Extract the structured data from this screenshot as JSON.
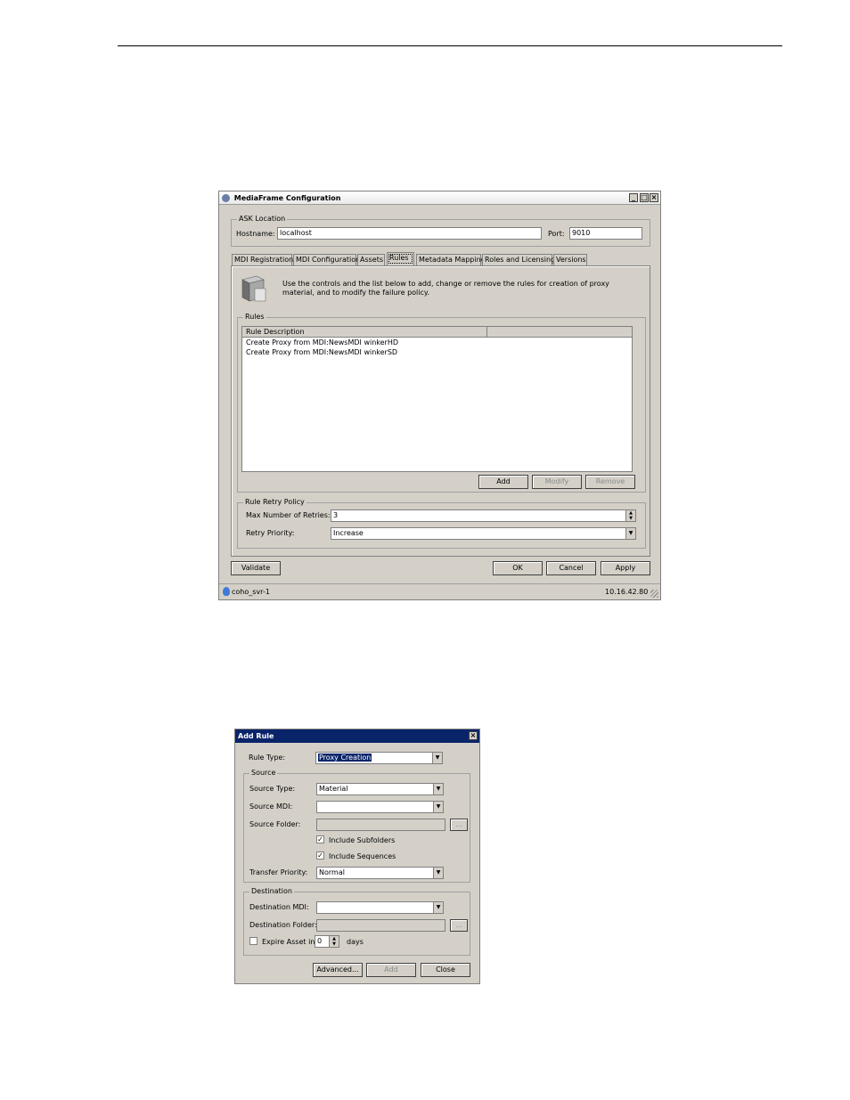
{
  "config_window": {
    "title": "MediaFrame Configuration",
    "ask_location": {
      "group_label": "ASK Location",
      "hostname_label": "Hostname:",
      "hostname_value": "localhost",
      "port_label": "Port:",
      "port_value": "9010"
    },
    "tabs": [
      {
        "label": "MDI Registration"
      },
      {
        "label": "MDI Configuration"
      },
      {
        "label": "Assets"
      },
      {
        "label": "Rules",
        "active": true
      },
      {
        "label": "Metadata Mapping"
      },
      {
        "label": "Roles and Licensing"
      },
      {
        "label": "Versions"
      }
    ],
    "description": "Use the controls and the list below to add, change or remove the rules for creation of proxy material, and to modify the failure policy.",
    "rules": {
      "group_label": "Rules",
      "column_header": "Rule Description",
      "rows": [
        "Create Proxy from MDI:NewsMDI winkerHD",
        "Create Proxy from MDI:NewsMDI winkerSD"
      ],
      "add_label": "Add",
      "modify_label": "Modify",
      "remove_label": "Remove"
    },
    "retry_policy": {
      "group_label": "Rule Retry Policy",
      "max_retries_label": "Max Number of Retries:",
      "max_retries_value": "3",
      "retry_priority_label": "Retry Priority:",
      "retry_priority_value": "Increase"
    },
    "validate_label": "Validate",
    "ok_label": "OK",
    "cancel_label": "Cancel",
    "apply_label": "Apply",
    "status": {
      "left": "coho_svr-1",
      "right": "10.16.42.80"
    }
  },
  "add_rule": {
    "title": "Add Rule",
    "rule_type_label": "Rule Type:",
    "rule_type_value": "Proxy Creation",
    "source": {
      "group_label": "Source",
      "source_type_label": "Source Type:",
      "source_type_value": "Material",
      "source_mdi_label": "Source MDI:",
      "source_mdi_value": "",
      "source_folder_label": "Source Folder:",
      "browse_label": "...",
      "include_subfolders_label": "Include Subfolders",
      "include_subfolders_checked": true,
      "include_sequences_label": "Include Sequences",
      "include_sequences_checked": true,
      "transfer_priority_label": "Transfer Priority:",
      "transfer_priority_value": "Normal"
    },
    "destination": {
      "group_label": "Destination",
      "destination_mdi_label": "Destination MDI:",
      "destination_mdi_value": "",
      "destination_folder_label": "Destination Folder:",
      "browse_label": "...",
      "expire_label": "Expire Asset in",
      "expire_checked": false,
      "expire_value": "0",
      "days_label": "days"
    },
    "advanced_label": "Advanced...",
    "add_label": "Add",
    "close_label": "Close"
  }
}
